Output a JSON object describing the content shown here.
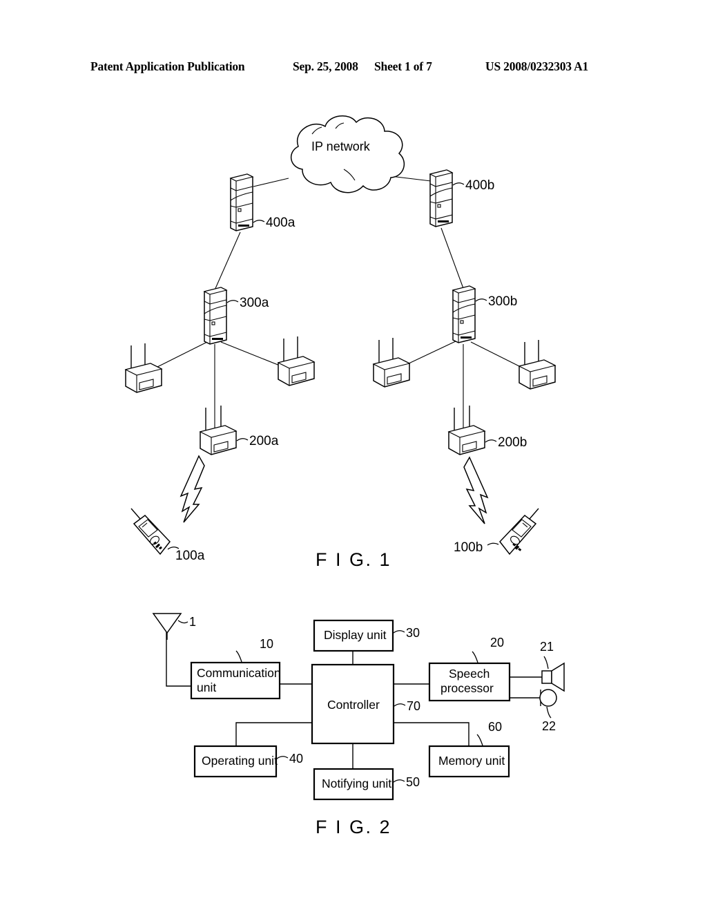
{
  "header": {
    "publication": "Patent Application Publication",
    "date": "Sep. 25, 2008",
    "sheet": "Sheet 1 of 7",
    "patent_number": "US 2008/0232303 A1"
  },
  "figure1": {
    "caption": "F I G. 1",
    "cloud_label": "IP network",
    "nodes": {
      "gateway_left": "400a",
      "gateway_right": "400b",
      "controller_left": "300a",
      "controller_right": "300b",
      "access_point_left": "200a",
      "access_point_right": "200b",
      "terminal_left": "100a",
      "terminal_right": "100b"
    },
    "icons": {
      "cloud": "cloud-icon",
      "server": "server-tower-icon",
      "access_point": "wireless-access-point-icon",
      "mobile": "mobile-phone-icon",
      "radio_wave": "radio-wave-icon"
    }
  },
  "figure2": {
    "caption": "F I G. 2",
    "blocks": [
      {
        "id": "antenna",
        "label": "",
        "ref": "1"
      },
      {
        "id": "communication",
        "label": "Communication unit",
        "ref": "10"
      },
      {
        "id": "speech",
        "label": "Speech processor",
        "ref": "20"
      },
      {
        "id": "speaker",
        "label": "",
        "ref": "21"
      },
      {
        "id": "microphone",
        "label": "",
        "ref": "22"
      },
      {
        "id": "display",
        "label": "Display unit",
        "ref": "30"
      },
      {
        "id": "operating",
        "label": "Operating unit",
        "ref": "40"
      },
      {
        "id": "notifying",
        "label": "Notifying unit",
        "ref": "50"
      },
      {
        "id": "memory",
        "label": "Memory unit",
        "ref": "60"
      },
      {
        "id": "controller",
        "label": "Controller",
        "ref": "70"
      }
    ],
    "labels": {
      "communication_line1": "Communication",
      "communication_line2": "unit",
      "speech_line1": "Speech",
      "speech_line2": "processor",
      "display": "Display  unit",
      "operating": "Operating  unit",
      "notifying": "Notifying  unit",
      "memory": "Memory  unit",
      "controller": "Controller"
    },
    "refs": {
      "antenna": "1",
      "communication": "10",
      "speech": "20",
      "speaker": "21",
      "microphone": "22",
      "display": "30",
      "operating": "40",
      "notifying": "50",
      "memory": "60",
      "controller": "70"
    },
    "icons": {
      "antenna": "antenna-icon",
      "speaker": "speaker-icon",
      "microphone": "microphone-icon"
    }
  },
  "colors": {
    "ink": "#000000",
    "paper": "#ffffff"
  }
}
